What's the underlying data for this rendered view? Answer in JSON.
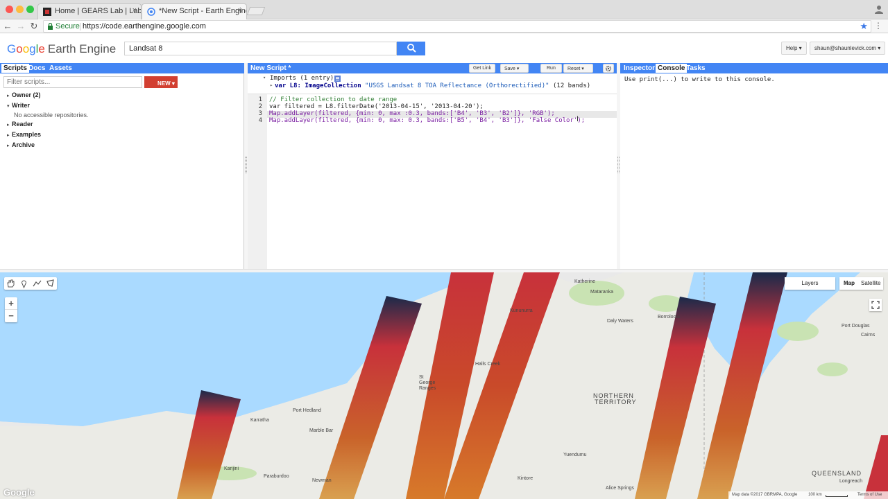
{
  "browser": {
    "tabs": [
      {
        "title": "Home | GEARS Lab | Lab 2",
        "close": "×"
      },
      {
        "title": "*New Script - Earth Engine Co",
        "close": "×"
      }
    ],
    "nav": {
      "back": "←",
      "forward": "→",
      "reload": "↻"
    },
    "secure_label": "Secure",
    "url": "https://code.earthengine.google.com",
    "star": "★",
    "menu": "⋮"
  },
  "header": {
    "logo_letters": [
      "G",
      "o",
      "o",
      "g",
      "l",
      "e"
    ],
    "logo_suffix": "Earth Engine",
    "search_value": "Landsat 8",
    "help_label": "Help ▾",
    "user_label": "shaun@shaunlevick.com ▾"
  },
  "left_panel": {
    "tabs": [
      "Scripts",
      "Docs",
      "Assets"
    ],
    "filter_placeholder": "Filter scripts...",
    "new_label": "NEW ▾",
    "tree": [
      {
        "arrow": "▸",
        "label": "Owner (2)"
      },
      {
        "arrow": "▾",
        "label": "Writer"
      },
      {
        "arrow": "",
        "label": "No accessible repositories."
      },
      {
        "arrow": "▸",
        "label": "Reader"
      },
      {
        "arrow": "▸",
        "label": "Examples"
      },
      {
        "arrow": "▸",
        "label": "Archive"
      }
    ]
  },
  "code_panel": {
    "title": "New Script *",
    "buttons": {
      "get_link": "Get Link",
      "save": "Save",
      "run": "Run",
      "reset": "Reset"
    },
    "imports_header": "Imports (1 entry)",
    "imports_var": "var L8: ImageCollection",
    "imports_value": "\"USGS Landsat 8 TOA Reflectance (Orthorectified)\"",
    "imports_bands": "(12 bands)",
    "line_numbers": [
      "1",
      "2",
      "3",
      "4"
    ],
    "lines": [
      "// Filter collection to date range",
      "var filtered = L8.filterDate('2013-04-15', '2013-04-20');",
      "Map.addLayer(filtered, {min: 0, max :0.3, bands:['B4', 'B3', 'B2']}, 'RGB');",
      "Map.addLayer(filtered, {min: 0, max: 0.3, bands:['B5', 'B4', 'B3']}, 'False Color');"
    ]
  },
  "right_panel": {
    "tabs": [
      "Inspector",
      "Console",
      "Tasks"
    ],
    "console_message": "Use print(...) to write to this console."
  },
  "map": {
    "layers_label": "Layers",
    "map_label": "Map",
    "satellite_label": "Satellite",
    "zoom_in": "+",
    "zoom_out": "−",
    "google_logo": "Google",
    "attribution": "Map data ©2017 GBRMPA, Google",
    "scale": "100 km",
    "terms": "Terms of Use",
    "places": [
      "Katherine",
      "Mataranka",
      "Daly Waters",
      "Borroloola",
      "Port Douglas",
      "Cairns",
      "Kununurra",
      "Halls Creek",
      "St George Ranges",
      "Port Hedland",
      "Karratha",
      "Marble Bar",
      "NORTHERN",
      "TERRITORY",
      "Yuendumu",
      "Paraburdoo",
      "Karijini",
      "Newman",
      "Kintore",
      "Alice Springs",
      "QUEENSLAND",
      "Longreach"
    ]
  }
}
